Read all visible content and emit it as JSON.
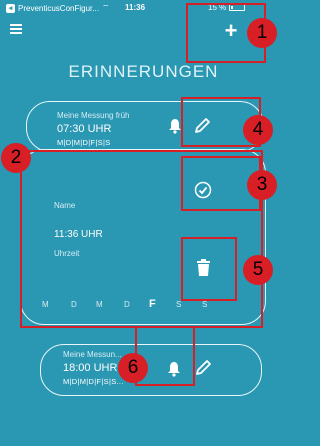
{
  "status_bar": {
    "carrier": "PreventicusConFigur...",
    "time": "11:36",
    "battery": "15 %"
  },
  "header": {
    "title": "ERINNERUNGEN",
    "add_label": "+"
  },
  "reminders": [
    {
      "name": "Meine Messung früh",
      "time": "07:30 UHR",
      "days": "M|D|M|D|F|S|S"
    },
    {
      "name_label": "Name",
      "time_value": "11:36 UHR",
      "time_label": "Uhrzeit",
      "weekdays": [
        "M",
        "D",
        "M",
        "D",
        "F",
        "S",
        "S"
      ],
      "active_day": "F"
    },
    {
      "name": "Meine Messun...",
      "time": "18:00 UHR",
      "days": "M|D|M|D|F|S|S..."
    }
  ],
  "callouts": [
    "1",
    "2",
    "3",
    "4",
    "5",
    "6"
  ],
  "colors": {
    "background": "#2a97b3",
    "highlight": "#d81f26",
    "card_border": "#e8f6fa"
  },
  "icons": [
    "menu-icon",
    "bell-icon",
    "pencil-icon",
    "check-circle-icon",
    "trash-icon"
  ]
}
